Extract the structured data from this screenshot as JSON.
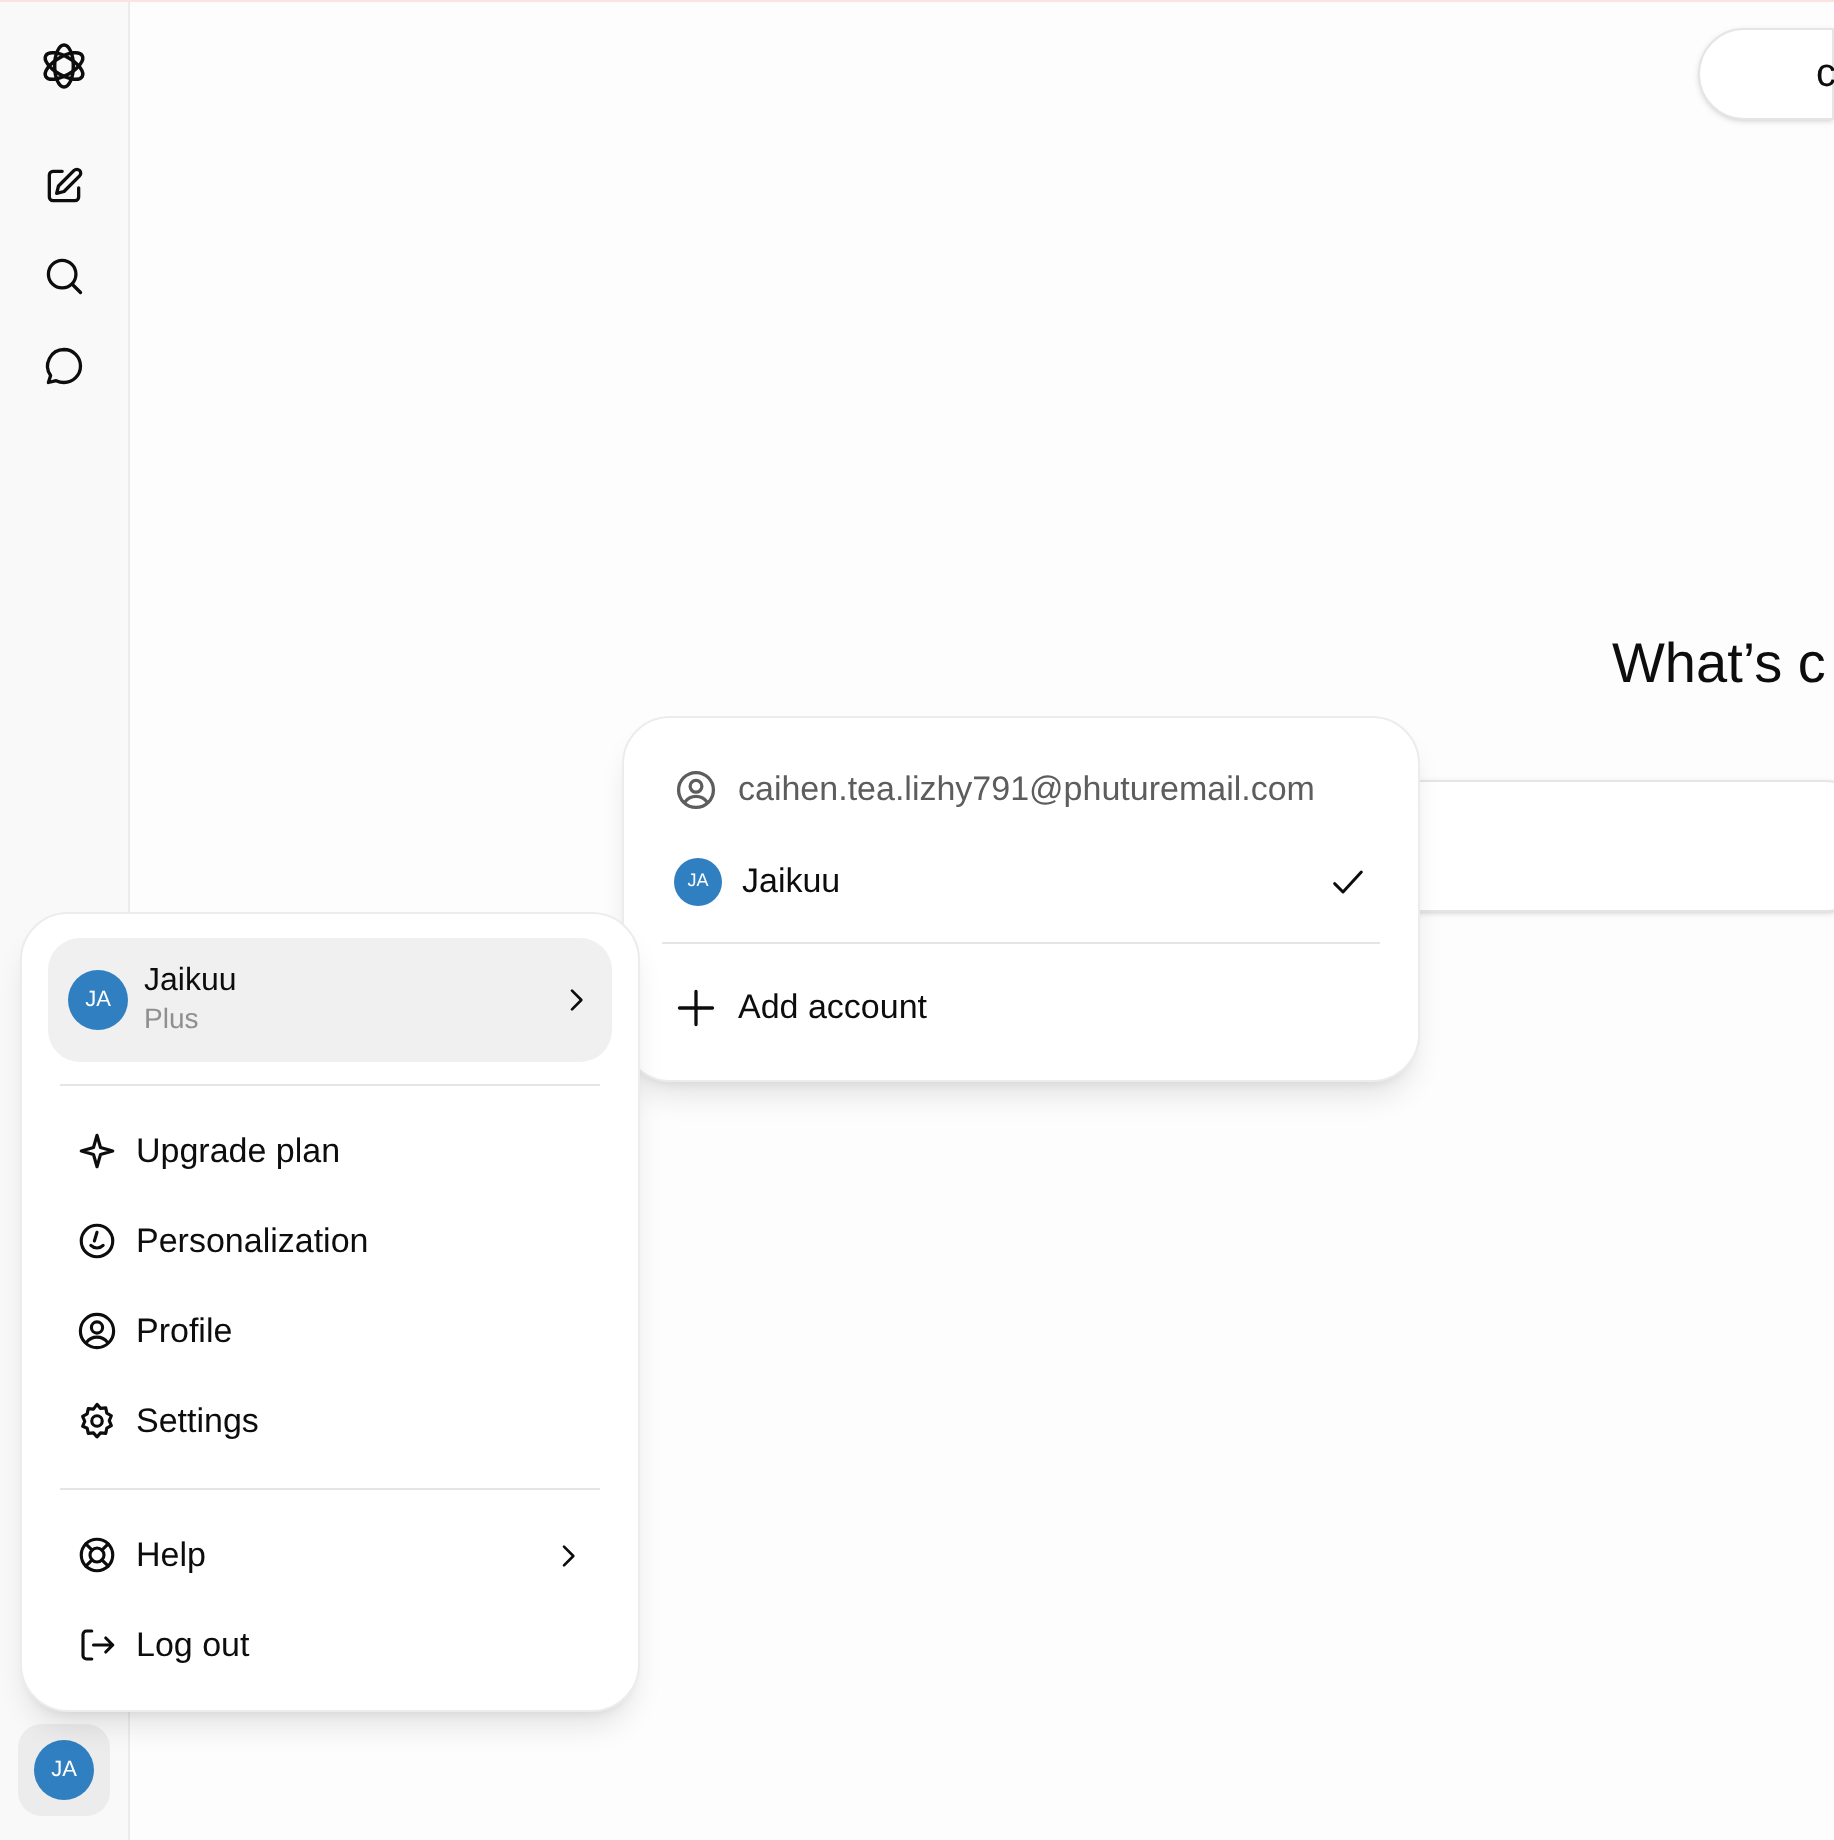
{
  "header": {
    "button_label": "c"
  },
  "main": {
    "heading": "What’s c"
  },
  "account_menu": {
    "user": {
      "initials": "JA",
      "name": "Jaikuu",
      "plan": "Plus",
      "highlighted": true,
      "has_submenu": true
    },
    "sections": [
      [
        {
          "label": "Upgrade plan",
          "has_submenu": false
        },
        {
          "label": "Personalization",
          "has_submenu": false
        },
        {
          "label": "Profile",
          "has_submenu": false
        },
        {
          "label": "Settings",
          "has_submenu": false
        }
      ],
      [
        {
          "label": "Help",
          "has_submenu": true
        },
        {
          "label": "Log out",
          "has_submenu": false
        }
      ]
    ]
  },
  "account_switcher": {
    "email": "caihen.tea.lizhy791@phuturemail.com",
    "accounts": [
      {
        "initials": "JA",
        "name": "Jaikuu",
        "selected": true
      }
    ],
    "add_label": "Add account"
  },
  "avatar_button": {
    "initials": "JA"
  }
}
